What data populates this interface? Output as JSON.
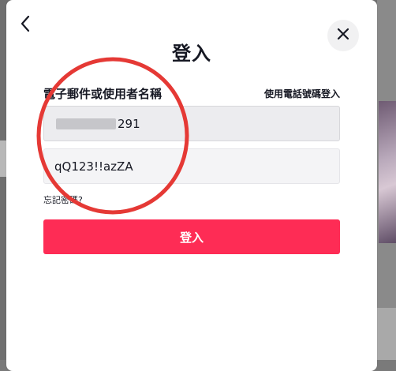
{
  "modal": {
    "title": "登入",
    "field_label": "電子郵件或使用者名稱",
    "alt_login_link": "使用電話號碼登入",
    "username_value_suffix": "291",
    "username_value_prefix": "",
    "password_value": "qQ123!!azZA",
    "forgot_password": "忘記密碼?",
    "login_button": "登入"
  },
  "colors": {
    "accent": "#fe2c55",
    "annotation": "#e53935"
  },
  "icons": {
    "back": "chevron-left-icon",
    "close": "close-icon"
  }
}
